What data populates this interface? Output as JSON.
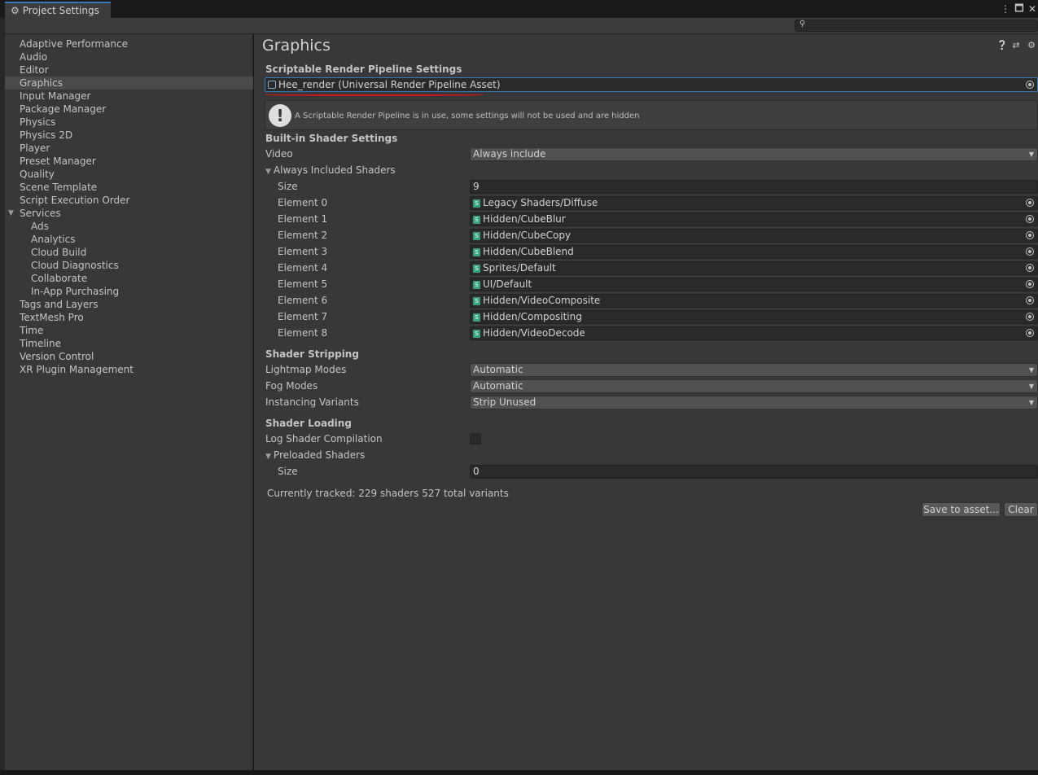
{
  "window": {
    "tab_title": "Project Settings",
    "controls": [
      "more-icon",
      "maximize-icon",
      "close-icon"
    ]
  },
  "search": {
    "placeholder": ""
  },
  "sidebar": {
    "items": [
      {
        "label": "Adaptive Performance"
      },
      {
        "label": "Audio"
      },
      {
        "label": "Editor"
      },
      {
        "label": "Graphics",
        "selected": true
      },
      {
        "label": "Input Manager"
      },
      {
        "label": "Package Manager"
      },
      {
        "label": "Physics"
      },
      {
        "label": "Physics 2D"
      },
      {
        "label": "Player"
      },
      {
        "label": "Preset Manager"
      },
      {
        "label": "Quality"
      },
      {
        "label": "Scene Template"
      },
      {
        "label": "Script Execution Order"
      },
      {
        "label": "Services",
        "expanded": true
      },
      {
        "label": "Ads",
        "sub": true
      },
      {
        "label": "Analytics",
        "sub": true
      },
      {
        "label": "Cloud Build",
        "sub": true
      },
      {
        "label": "Cloud Diagnostics",
        "sub": true
      },
      {
        "label": "Collaborate",
        "sub": true
      },
      {
        "label": "In-App Purchasing",
        "sub": true
      },
      {
        "label": "Tags and Layers"
      },
      {
        "label": "TextMesh Pro"
      },
      {
        "label": "Time"
      },
      {
        "label": "Timeline"
      },
      {
        "label": "Version Control"
      },
      {
        "label": "XR Plugin Management"
      }
    ]
  },
  "main": {
    "title": "Graphics",
    "header_icons": [
      "help-icon",
      "presets-icon",
      "settings-icon"
    ],
    "srp": {
      "heading": "Scriptable Render Pipeline Settings",
      "asset_value": "Hee_render (Universal Render Pipeline Asset)",
      "help_message": "A Scriptable Render Pipeline is in use, some settings will not be used and are hidden"
    },
    "builtin": {
      "heading": "Built-in Shader Settings",
      "video_label": "Video",
      "video_value": "Always include",
      "always_included_label": "Always Included Shaders",
      "size_label": "Size",
      "size_value": "9",
      "elements": [
        {
          "label": "Element 0",
          "value": "Legacy Shaders/Diffuse"
        },
        {
          "label": "Element 1",
          "value": "Hidden/CubeBlur"
        },
        {
          "label": "Element 2",
          "value": "Hidden/CubeCopy"
        },
        {
          "label": "Element 3",
          "value": "Hidden/CubeBlend"
        },
        {
          "label": "Element 4",
          "value": "Sprites/Default"
        },
        {
          "label": "Element 5",
          "value": "UI/Default"
        },
        {
          "label": "Element 6",
          "value": "Hidden/VideoComposite"
        },
        {
          "label": "Element 7",
          "value": "Hidden/Compositing"
        },
        {
          "label": "Element 8",
          "value": "Hidden/VideoDecode"
        }
      ]
    },
    "stripping": {
      "heading": "Shader Stripping",
      "lightmap_label": "Lightmap Modes",
      "lightmap_value": "Automatic",
      "fog_label": "Fog Modes",
      "fog_value": "Automatic",
      "instancing_label": "Instancing Variants",
      "instancing_value": "Strip Unused"
    },
    "loading": {
      "heading": "Shader Loading",
      "log_label": "Log Shader Compilation",
      "log_checked": false,
      "preloaded_label": "Preloaded Shaders",
      "size_label": "Size",
      "size_value": "0"
    },
    "tracked_text": "Currently tracked: 229 shaders 527 total variants",
    "save_button": "Save to asset...",
    "clear_button": "Clear"
  },
  "colors": {
    "accent": "#3a79bb",
    "panel": "#383838",
    "field": "#2a2a2a",
    "annotation": "#d31414"
  }
}
